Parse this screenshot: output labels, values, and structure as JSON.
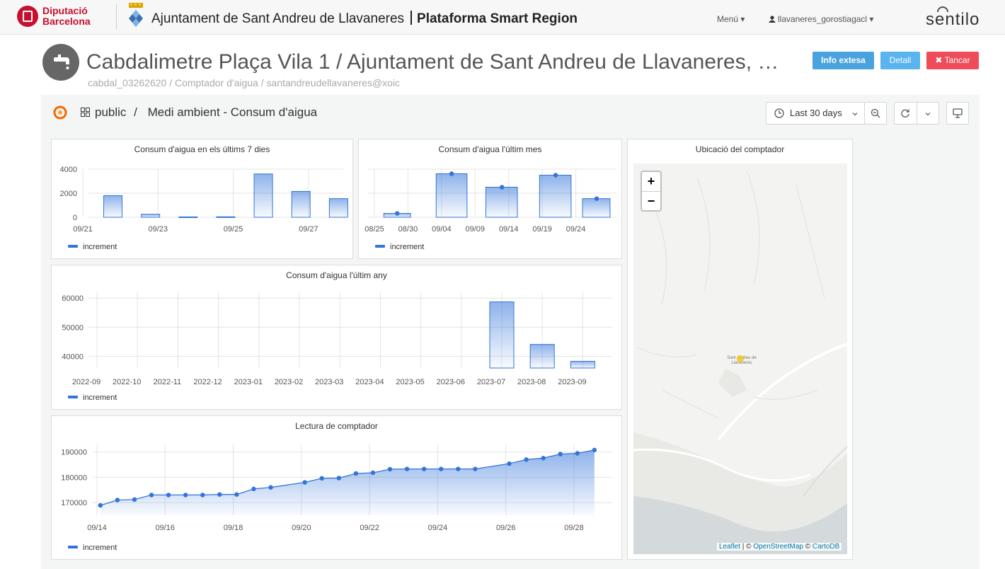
{
  "topbar": {
    "brand": [
      "Diputació",
      "Barcelona"
    ],
    "town": "Ajuntament de Sant Andreu de Llavaneres",
    "platform": "Plataforma Smart Region",
    "menu": "Menú ▾",
    "user": "llavaneres_gorostiagacl ▾",
    "logo_text": "sentilo"
  },
  "header": {
    "title": "Cabdalimetre Plaça Vila 1 / Ajuntament de Sant Andreu de Llavaneres, …",
    "subtitle": "cabdal_03262620 / Comptador d'aigua / santandreudellavaneres@xoic",
    "buttons": {
      "info": "Info extesa",
      "detail": "Detall",
      "close": "✖ Tancar"
    }
  },
  "dashboard": {
    "folder": "public",
    "separator": "/",
    "name": "Medi ambient - Consum d'aigua",
    "time_range": "Last 30 days"
  },
  "colors": {
    "series": "#3274d9",
    "accent_blue": "#4aa3df",
    "close_red": "#ef4c59"
  },
  "panels": {
    "week": {
      "title": "Consum d'aigua en els últims 7 dies",
      "legend": "increment"
    },
    "month": {
      "title": "Consum d'aigua l'últim mes",
      "legend": "increment"
    },
    "year": {
      "title": "Consum d'aigua l'últim any",
      "legend": "increment"
    },
    "meter": {
      "title": "Lectura de comptador",
      "legend": "increment"
    },
    "map": {
      "title": "Ubicació del comptador",
      "zoom_in": "+",
      "zoom_out": "−",
      "place": "Sant Andreu de Llavaneres",
      "place_lines": [
        "Sant Andreu de",
        "Llavaneres"
      ],
      "attribution": {
        "leaflet": "Leaflet",
        "sep": " | © ",
        "osm": "OpenStreetMap",
        "sep2": " © ",
        "carto": "CartoDB"
      }
    }
  },
  "chart_data": [
    {
      "type": "bar",
      "title": "Consum d'aigua en els últims 7 dies",
      "x_tick_labels": [
        "09/21",
        "09/23",
        "09/25",
        "09/27"
      ],
      "y_tick_labels": [
        "4000",
        "2000",
        "0"
      ],
      "ylim": [
        0,
        4000
      ],
      "bar_x": [
        21.8,
        22.8,
        23.8,
        24.8,
        25.8,
        26.8,
        27.8
      ],
      "series": [
        {
          "name": "increment",
          "values": [
            1800,
            250,
            30,
            40,
            3600,
            2150,
            1550
          ]
        }
      ],
      "grid": true,
      "legend": "bottom-left"
    },
    {
      "type": "bar",
      "title": "Consum d'aigua l'últim mes",
      "x_tick_labels": [
        "08/25",
        "08/30",
        "09/04",
        "09/09",
        "09/14",
        "09/19",
        "09/24"
      ],
      "day_offsets": [
        0,
        5,
        10,
        15,
        20,
        25,
        30
      ],
      "ylim": [
        0,
        4000
      ],
      "bar_start": [
        1.4,
        9.2,
        16.6,
        24.6,
        31.0
      ],
      "bar_end": [
        5.4,
        13.8,
        21.3,
        29.3,
        35.1
      ],
      "dot_x": [
        3.4,
        11.5,
        19.0,
        27.0,
        33.1
      ],
      "series": [
        {
          "name": "increment",
          "values": [
            320,
            3620,
            2500,
            3500,
            1550
          ]
        }
      ],
      "grid": true,
      "legend": "bottom-left"
    },
    {
      "type": "bar",
      "title": "Consum d'aigua l'últim any",
      "x_tick_labels": [
        "2022-09",
        "2022-10",
        "2022-11",
        "2022-12",
        "2023-01",
        "2023-02",
        "2023-03",
        "2023-04",
        "2023-05",
        "2023-06",
        "2023-07",
        "2023-08",
        "2023-09"
      ],
      "y_tick_labels": [
        "60000",
        "50000",
        "40000"
      ],
      "ylim": [
        36000,
        62000
      ],
      "bar_categories": [
        "2023-07",
        "2023-08",
        "2023-09"
      ],
      "series": [
        {
          "name": "increment",
          "values": [
            58700,
            44100,
            38300
          ]
        }
      ],
      "grid": true,
      "legend": "bottom-left"
    },
    {
      "type": "area",
      "title": "Lectura de comptador",
      "x_tick_labels": [
        "09/14",
        "09/16",
        "09/18",
        "09/20",
        "09/22",
        "09/24",
        "09/26",
        "09/28"
      ],
      "y_tick_labels": [
        "190000",
        "180000",
        "170000"
      ],
      "ylim": [
        165000,
        193000
      ],
      "x": [
        14.1,
        14.6,
        15.1,
        15.6,
        16.1,
        16.6,
        17.1,
        17.6,
        18.1,
        18.6,
        19.1,
        19.6,
        20.1,
        20.6,
        21.1,
        21.6,
        22.1,
        22.6,
        23.1,
        23.6,
        24.1,
        24.6,
        25.1,
        25.6,
        26.1,
        26.6,
        27.1,
        27.6,
        28.1,
        28.6
      ],
      "series": [
        {
          "name": "increment",
          "values": [
            168900,
            171000,
            171200,
            173000,
            173000,
            173000,
            173000,
            173200,
            173200,
            175400,
            176000,
            null,
            178000,
            179600,
            179700,
            181500,
            181800,
            183200,
            183300,
            183300,
            183300,
            183300,
            183300,
            null,
            185400,
            187000,
            187600,
            189200,
            189500,
            190800
          ]
        }
      ],
      "grid": true,
      "legend": "bottom-left"
    }
  ]
}
